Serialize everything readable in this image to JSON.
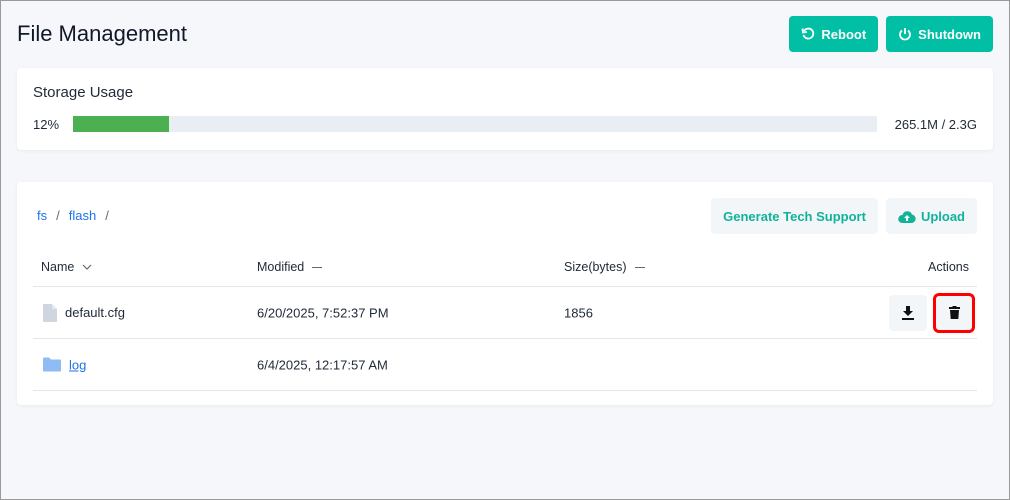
{
  "header": {
    "title": "File Management",
    "reboot": "Reboot",
    "shutdown": "Shutdown"
  },
  "storage": {
    "title": "Storage Usage",
    "percent_label": "12%",
    "percent": 12,
    "total": "265.1M / 2.3G",
    "color": "#4caf50"
  },
  "breadcrumb": [
    "fs",
    "flash"
  ],
  "breadcrumb_sep": "/",
  "toolbar": {
    "tech_support": "Generate Tech Support",
    "upload": "Upload"
  },
  "table": {
    "columns": {
      "name": "Name",
      "modified": "Modified",
      "size": "Size(bytes)",
      "actions": "Actions"
    },
    "rows": [
      {
        "name": "default.cfg",
        "type": "file",
        "modified": "6/20/2025, 7:52:37 PM",
        "size": "1856"
      },
      {
        "name": "log",
        "type": "folder",
        "modified": "6/4/2025, 12:17:57 AM",
        "size": ""
      }
    ]
  }
}
